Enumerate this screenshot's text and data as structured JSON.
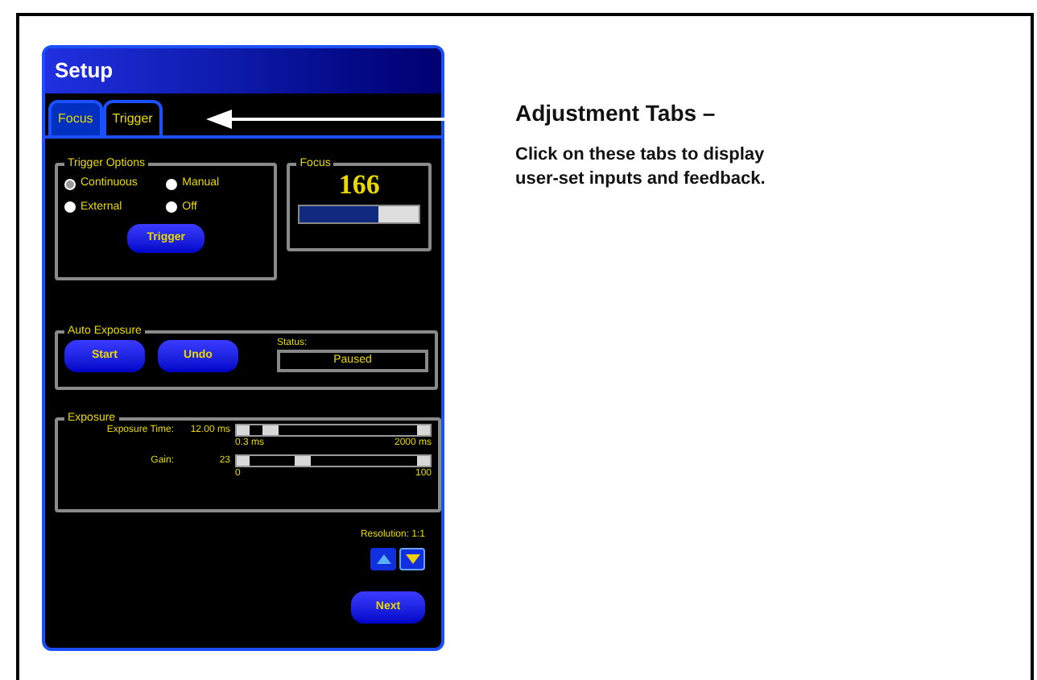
{
  "panel": {
    "title": "Setup",
    "tabs": [
      {
        "label": "Focus",
        "selected": true
      },
      {
        "label": "Trigger",
        "selected": false
      }
    ],
    "trigger_options": {
      "label": "Trigger Options",
      "options": [
        {
          "label": "Continuous",
          "selected": true
        },
        {
          "label": "Manual",
          "selected": false
        },
        {
          "label": "External",
          "selected": false
        },
        {
          "label": "Off",
          "selected": false
        }
      ],
      "button": "Trigger"
    },
    "focus": {
      "label": "Focus",
      "value": "166",
      "level": 0.66
    },
    "auto_exposure": {
      "label": "Auto Exposure",
      "buttons": [
        "Start",
        "Undo"
      ],
      "status_label": "Status:",
      "status": "Paused"
    },
    "exposure": {
      "label": "Exposure",
      "sliders": [
        {
          "label": "Exposure Time:",
          "value": "12.00 ms",
          "min": "0.3 ms",
          "max": "2000 ms",
          "level": 0.08
        },
        {
          "label": "Gain:",
          "value": "23",
          "min": "0",
          "max": "100",
          "level": 0.3
        }
      ]
    },
    "resolution": "Resolution: 1:1",
    "next": "Next"
  },
  "annotation": {
    "title": "Adjustment Tabs –",
    "description": [
      "Click on these tabs to display",
      "user-set inputs and feedback."
    ]
  }
}
